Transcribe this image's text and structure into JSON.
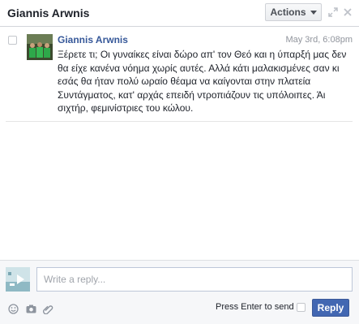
{
  "header": {
    "title": "Giannis Arwnis",
    "actions_label": "Actions",
    "icons": [
      "chevron-down-icon",
      "expand-icon",
      "close-icon"
    ]
  },
  "message": {
    "sender": "Giannis Arwnis",
    "timestamp": "May 3rd, 6:08pm",
    "body": "Ξέρετε τι; Οι γυναίκες είναι δώρο απ' τον Θεό και η ύπαρξή μας δεν θα είχε κανένα νόημα χωρίς αυτές. Αλλά κάτι μαλακισμένες σαν κι εσάς θα ήταν πολύ ωραίο θέαμα να καίγονται στην πλατεία Συντάγματος, κατ' αρχάς επειδή ντροπιάζουν τις υπόλοιπες. Άι σιχτήρ, φεμινίστριες του κώλου."
  },
  "composer": {
    "placeholder": "Write a reply...",
    "value": "",
    "press_enter_label": "Press Enter to send",
    "reply_label": "Reply",
    "tool_icons": [
      "emoji-icon",
      "camera-icon",
      "attach-icon"
    ]
  },
  "colors": {
    "link": "#365899",
    "button": "#4267b2",
    "muted": "#90949c"
  }
}
